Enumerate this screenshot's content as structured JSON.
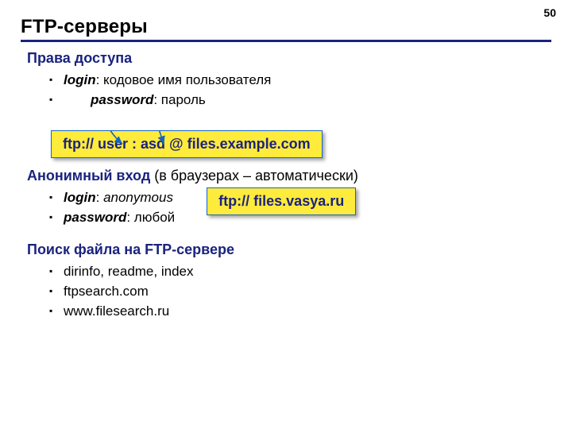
{
  "page_number": "50",
  "title": "FTP-серверы",
  "section1": {
    "heading": "Права доступа",
    "items": [
      {
        "term": "login",
        "desc": ": кодовое имя пользователя"
      },
      {
        "term": "password",
        "desc": ": пароль",
        "indent": true
      }
    ]
  },
  "callout1": "ftp:// user : asd @ files.example.com",
  "section2": {
    "heading": "Анонимный вход",
    "note": " (в браузерах – автоматически)",
    "items": [
      {
        "term": "login",
        "value": "anonymous"
      },
      {
        "term": "password",
        "desc": ": любой"
      }
    ]
  },
  "callout2": "ftp:// files.vasya.ru",
  "section3": {
    "heading": "Поиск файла на FTP-сервере",
    "items": [
      {
        "text": "dirinfo, readme, index"
      },
      {
        "text": "ftpsearch.com"
      },
      {
        "text": "www.filesearch.ru"
      }
    ]
  }
}
